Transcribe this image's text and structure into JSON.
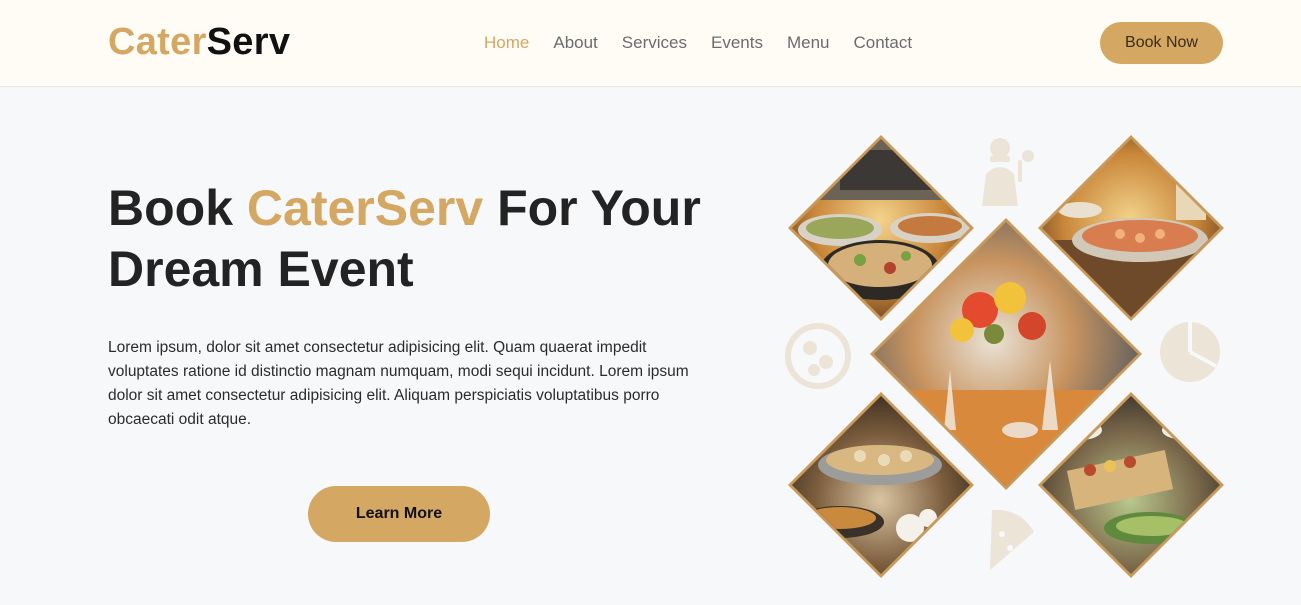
{
  "header": {
    "brand_part1": "Cater",
    "brand_part2": "Serv",
    "nav": [
      "Home",
      "About",
      "Services",
      "Events",
      "Menu",
      "Contact"
    ],
    "active_nav": "Home",
    "book_label": "Book Now"
  },
  "hero": {
    "title_before": "Book ",
    "title_accent": "CaterServ",
    "title_after": " For Your Dream Event",
    "text": "Lorem ipsum, dolor sit amet consectetur adipisicing elit. Quam quaerat impedit voluptates ratione id distinctio magnam numquam, modi sequi incidunt. Lorem ipsum dolor sit amet consectetur adipisicing elit. Aliquam perspiciatis voluptatibus porro obcaecati odit atque.",
    "cta_label": "Learn More"
  },
  "gallery": {
    "tiles": [
      "salad-buffet-photo",
      "seafood-platter-photo",
      "table-setting-photo",
      "buffet-trays-photo",
      "appetizer-board-photo"
    ],
    "decor_icons": [
      "chef-icon",
      "pizza-icon",
      "pizza-slice-icon"
    ]
  },
  "colors": {
    "accent": "#d4a762",
    "nav_text": "#6c6c6c",
    "heading": "#232323",
    "background": "#f7f8fa",
    "header_bg": "#fffcf6"
  }
}
